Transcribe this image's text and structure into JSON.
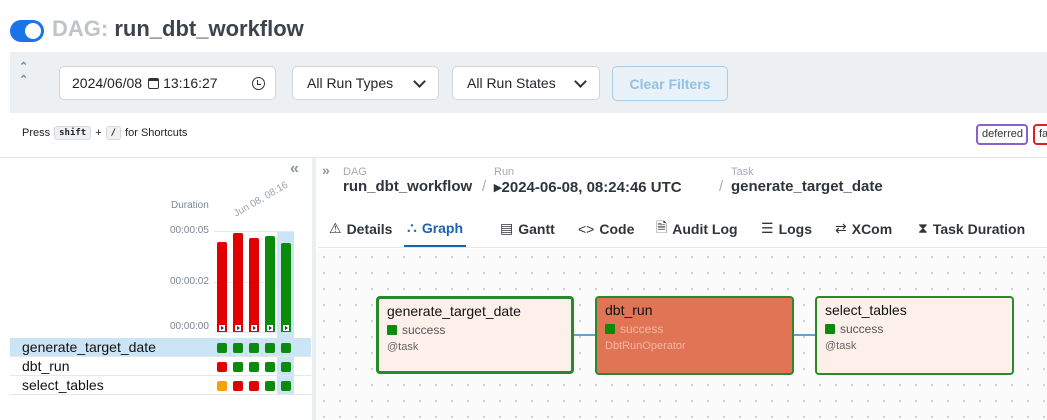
{
  "header": {
    "prefix": "DAG:",
    "dag_name": "run_dbt_workflow",
    "toggle_on": true,
    "accent": "#1a73e8"
  },
  "filters": {
    "collapse_icon": "chevron-double-up-icon",
    "base_date": "2024/06/08",
    "base_time": "13:16:27",
    "run_types": "All Run Types",
    "run_states": "All Run States",
    "clear_label": "Clear Filters"
  },
  "shortcuts": {
    "press": "Press",
    "key1": "shift",
    "plus": "+",
    "key2": "/",
    "suffix": "for Shortcuts"
  },
  "legend_badges": [
    {
      "label": "deferred",
      "color": "#8a5fd0"
    },
    {
      "label": "failed",
      "color": "#e02020"
    }
  ],
  "grid": {
    "duration_label": "Duration",
    "date_label": "Jun 08, 08:16",
    "y_ticks": [
      "00:00:05",
      "00:00:02",
      "00:00:00"
    ],
    "runs": [
      {
        "state": "failed",
        "color": "#e00000",
        "duration_frac": 0.89
      },
      {
        "state": "failed",
        "color": "#e00000",
        "duration_frac": 0.98
      },
      {
        "state": "failed",
        "color": "#e00000",
        "duration_frac": 0.93
      },
      {
        "state": "success",
        "color": "#0b8a0b",
        "duration_frac": 0.95
      },
      {
        "state": "success",
        "color": "#0b8a0b",
        "duration_frac": 0.88
      }
    ],
    "tasks": [
      {
        "name": "generate_target_date",
        "states": [
          "#0b8a0b",
          "#0b8a0b",
          "#0b8a0b",
          "#0b8a0b",
          "#0b8a0b"
        ]
      },
      {
        "name": "dbt_run",
        "states": [
          "#e00000",
          "#0b8a0b",
          "#0b8a0b",
          "#0b8a0b",
          "#0b8a0b"
        ]
      },
      {
        "name": "select_tables",
        "states": [
          "#f4a300",
          "#e00000",
          "#e00000",
          "#0b8a0b",
          "#0b8a0b"
        ]
      }
    ]
  },
  "breadcrumb": {
    "dag_label": "DAG",
    "dag_value": "run_dbt_workflow",
    "run_label": "Run",
    "run_value": "▸2024-06-08, 08:24:46 UTC",
    "task_label": "Task",
    "task_value": "generate_target_date",
    "sep": "/"
  },
  "tabs": [
    {
      "label": "Details",
      "icon": "⚠"
    },
    {
      "label": "Graph",
      "icon": "⛬"
    },
    {
      "label": "Gantt",
      "icon": "▤"
    },
    {
      "label": "Code",
      "icon": "<>"
    },
    {
      "label": "Audit Log",
      "icon": "🗎"
    },
    {
      "label": "Logs",
      "icon": "☰"
    },
    {
      "label": "XCom",
      "icon": "⇄"
    },
    {
      "label": "Task Duration",
      "icon": "⧗"
    }
  ],
  "graph": {
    "nodes": [
      {
        "name": "generate_target_date",
        "state": "success",
        "operator": "@task",
        "fill": "#fdf0ea"
      },
      {
        "name": "dbt_run",
        "state": "success",
        "operator": "DbtRunOperator",
        "fill": "#e07455"
      },
      {
        "name": "select_tables",
        "state": "success",
        "operator": "@task",
        "fill": "#fdf0ea"
      }
    ]
  }
}
